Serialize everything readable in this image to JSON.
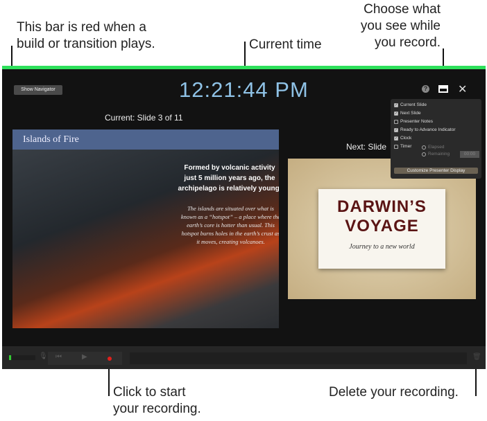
{
  "callouts": {
    "bar": "This bar is red when a build or transition plays.",
    "bar1": "This bar is red when a",
    "bar2": "build or transition plays.",
    "time": "Current time",
    "choose1": "Choose what",
    "choose2": "you see while",
    "choose3": "you record.",
    "start1": "Click to start",
    "start2": "your recording.",
    "delete": "Delete your recording."
  },
  "toolbar": {
    "show_navigator": "Show Navigator",
    "clock": "12:21:44 PM"
  },
  "current": {
    "label": "Current: Slide 3 of 11",
    "title": "Islands of Fire",
    "bold": "Formed by volcanic activity just 5 million years ago, the archipelago is relatively young.",
    "body": "The islands are situated over what is known as a “hotspot” – a place where the earth’s core is hotter than usual. This hotspot burns holes in the earth’s crust as it moves, creating volcanoes."
  },
  "next": {
    "label": "Next: Slide",
    "title1": "DARWIN’S",
    "title2": "VOYAGE",
    "subtitle": "Journey to a new world"
  },
  "popover": {
    "options": [
      {
        "label": "Current Slide",
        "checked": true
      },
      {
        "label": "Next Slide",
        "checked": true
      },
      {
        "label": "Presenter Notes",
        "checked": false
      },
      {
        "label": "Ready to Advance Indicator",
        "checked": true
      },
      {
        "label": "Clock",
        "checked": true
      },
      {
        "label": "Timer",
        "checked": false
      }
    ],
    "elapsed": "Elapsed",
    "remaining": "Remaining",
    "timer_value": "00:00",
    "customize": "Customize Presenter Display"
  },
  "colors": {
    "progress_bar": "#2ee05b",
    "title_bar": "#4e648e",
    "record": "#e0201c"
  }
}
